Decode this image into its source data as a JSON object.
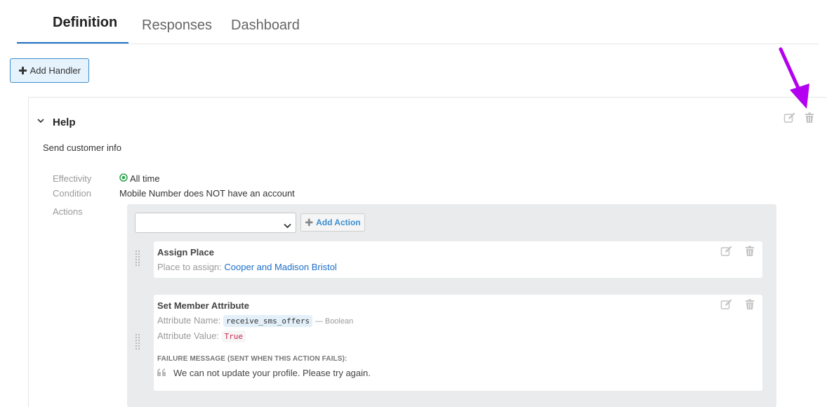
{
  "tabs": [
    {
      "label": "Definition",
      "active": true
    },
    {
      "label": "Responses",
      "active": false
    },
    {
      "label": "Dashboard",
      "active": false
    }
  ],
  "add_handler": {
    "label": "Add Handler",
    "icon": "plus-icon"
  },
  "handler": {
    "title": "Help",
    "description": "Send customer info",
    "effectivity_label": "Effectivity",
    "effectivity_value": "All time",
    "condition_label": "Condition",
    "condition_value": "Mobile Number does NOT have an account",
    "actions_label": "Actions",
    "icons": [
      "edit-icon",
      "trash-icon"
    ]
  },
  "actions": {
    "select_value": "",
    "add_action_label": "Add Action",
    "items": [
      {
        "title": "Assign Place",
        "place_label": "Place to assign:",
        "place_value": "Cooper and Madison Bristol"
      },
      {
        "title": "Set Member Attribute",
        "attr_name_label": "Attribute Name:",
        "attr_name_value": "receive_sms_offers",
        "attr_type": "— Boolean",
        "attr_value_label": "Attribute Value:",
        "attr_value": "True",
        "failure_label": "FAILURE MESSAGE (SENT WHEN THIS ACTION FAILS):",
        "failure_message": "We can not update your profile. Please try again."
      }
    ]
  },
  "colors": {
    "accent": "#1e73c9",
    "annotation_arrow": "#b400f0",
    "actions_bg": "#e9ebec",
    "button_bg": "#e6f3fc",
    "success": "#2fa44f"
  }
}
